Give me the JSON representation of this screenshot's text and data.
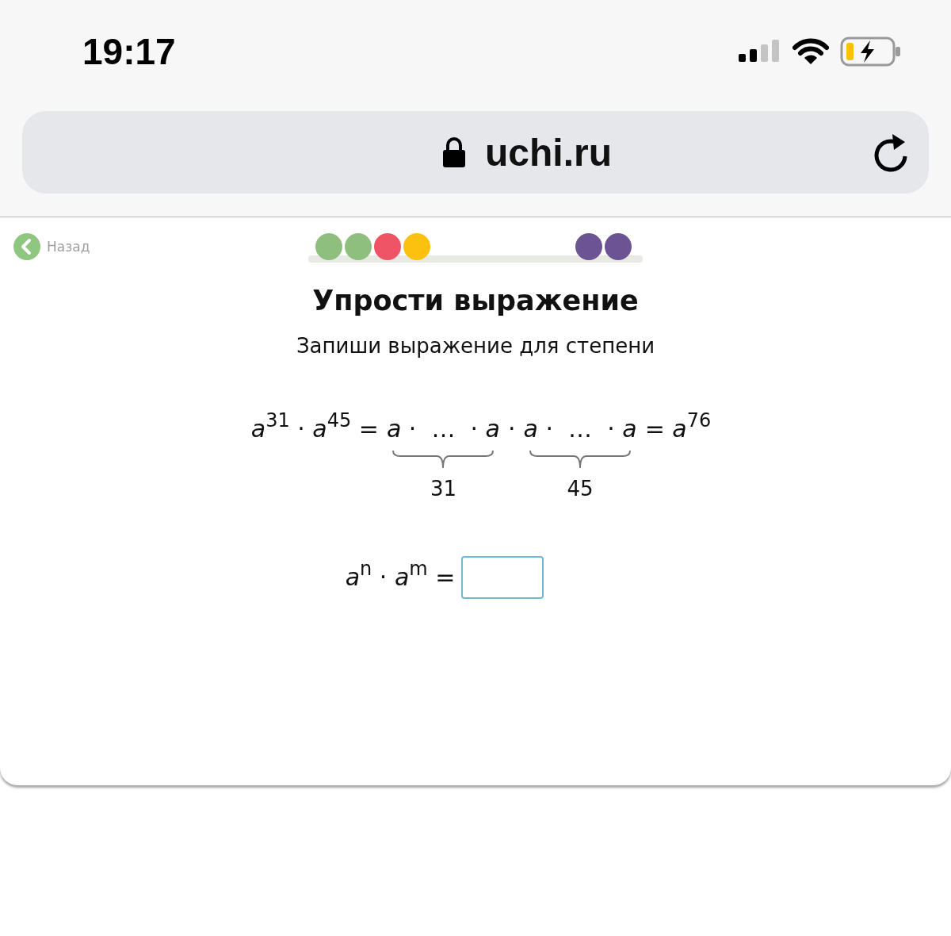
{
  "status_bar": {
    "time": "19:17"
  },
  "address_bar": {
    "url": "uchi.ru"
  },
  "back_link": {
    "label": "Назад"
  },
  "progress": {
    "left_dots": [
      {
        "color": "#8fbf7f"
      },
      {
        "color": "#8fbf7f"
      },
      {
        "color": "#ef5466"
      },
      {
        "color": "#fcc10e"
      }
    ],
    "right_dots": [
      {
        "color": "#6c5393"
      },
      {
        "color": "#6c5393"
      }
    ]
  },
  "title": "Упрости выражение",
  "subtitle": "Запиши выражение для степени",
  "example": {
    "lead": "*a*$^{31}$ · *a*$^{45}$ =",
    "groups": [
      {
        "text": "*a* ·  …  · *a*",
        "count": "31"
      },
      {
        "text": "*a* ·  …  · *a*",
        "count": "45"
      }
    ],
    "joiner": "·",
    "result": "= *a*$^{76}$"
  },
  "task": {
    "expression": "*a*$^{n}$ · *a*$^{m}$ ="
  }
}
